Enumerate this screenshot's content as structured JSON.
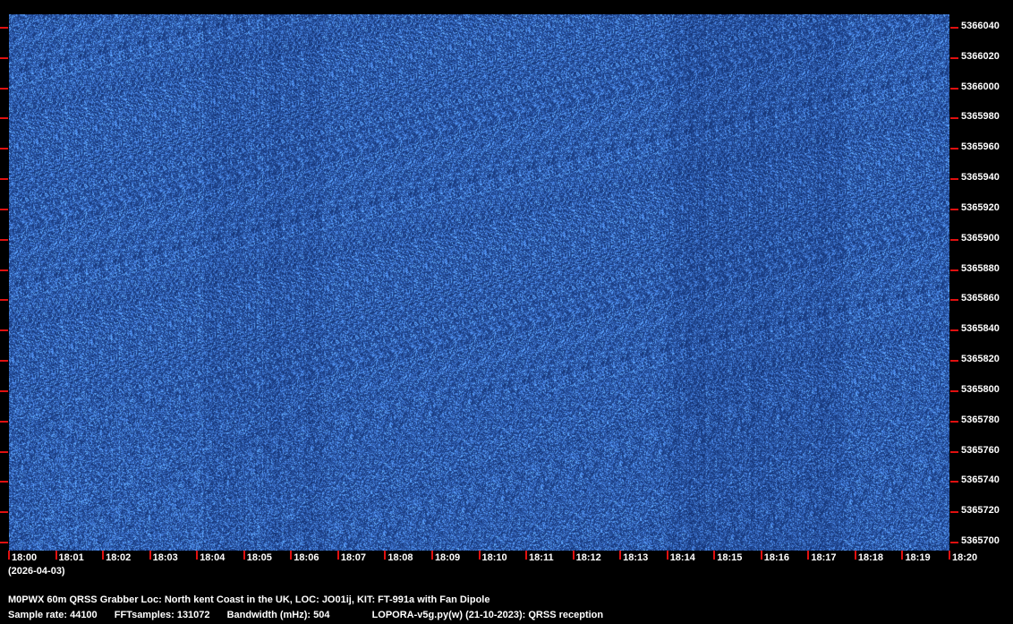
{
  "chart_data": {
    "type": "heatmap",
    "title": "M0PWX 60m QRSS Grabber Loc: North kent Coast in the UK, LOC: JO01ij, KIT: FT-991a with Fan Dipole",
    "xlabel": "(2026-04-03)",
    "ylabel": "",
    "x_ticks": [
      "18:00",
      "18:01",
      "18:02",
      "18:03",
      "18:04",
      "18:05",
      "18:06",
      "18:07",
      "18:08",
      "18:09",
      "18:10",
      "18:11",
      "18:12",
      "18:13",
      "18:14",
      "18:15",
      "18:16",
      "18:17",
      "18:18",
      "18:19",
      "18:20"
    ],
    "y_ticks": [
      "5366040",
      "5366020",
      "5366000",
      "5365980",
      "5365960",
      "5365940",
      "5365920",
      "5365900",
      "5365880",
      "5365860",
      "5365840",
      "5365820",
      "5365800",
      "5365780",
      "5365760",
      "5365740",
      "5365720",
      "5365700"
    ],
    "xlim": [
      "18:00",
      "18:20"
    ],
    "ylim": [
      5365700,
      5366040
    ],
    "colors": {
      "background": "#0b2a66",
      "signal": "#6fa0e0",
      "tick": "#e01010"
    }
  },
  "footer": {
    "title": "M0PWX 60m QRSS Grabber Loc: North kent Coast in the UK, LOC: JO01ij, KIT: FT-991a with Fan Dipole",
    "sample_rate": "Sample rate: 44100",
    "fft_samples": "FFTsamples: 131072",
    "bandwidth": "Bandwidth (mHz): 504",
    "software": "LOPORA-v5g.py(w) (21-10-2023): QRSS reception"
  }
}
